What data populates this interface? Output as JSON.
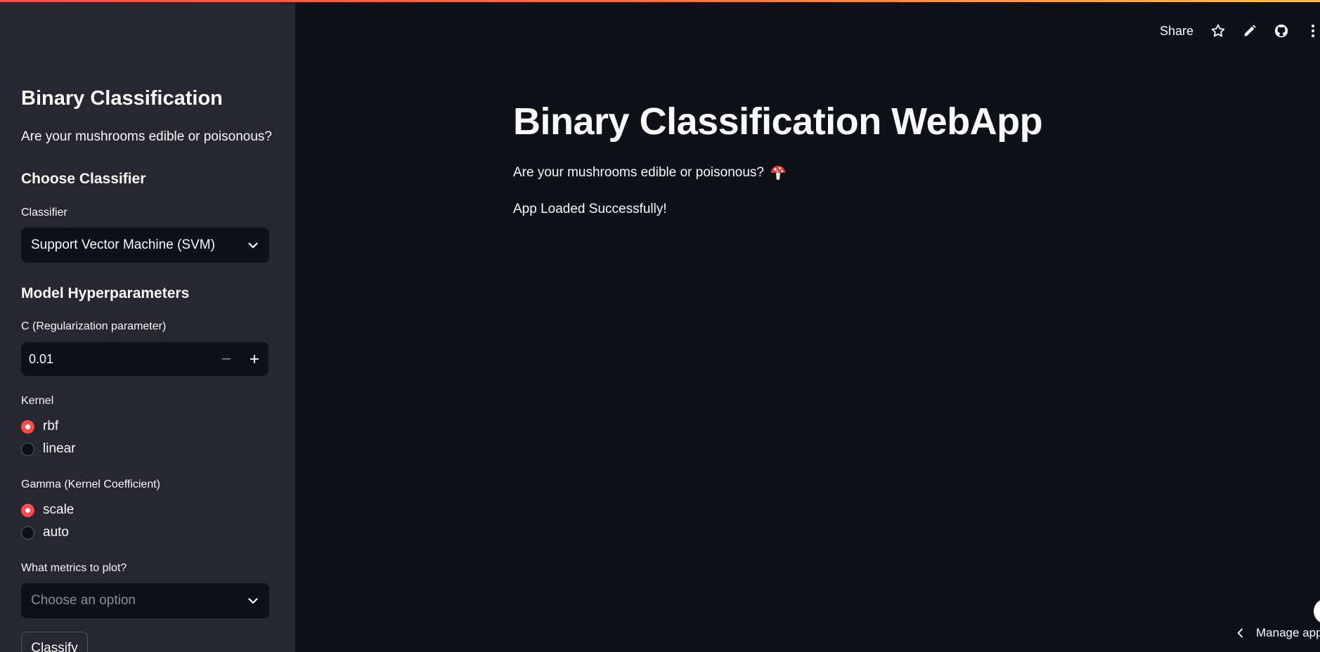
{
  "header": {
    "share_label": "Share",
    "icons": [
      "star-icon",
      "pencil-icon",
      "github-icon",
      "more-vertical-icon"
    ]
  },
  "sidebar": {
    "title": "Binary Classification",
    "subtitle": "Are your mushrooms edible or poisonous?",
    "choose_classifier_heading": "Choose Classifier",
    "classifier_label": "Classifier",
    "classifier_value": "Support Vector Machine (SVM)",
    "hyperparameters_heading": "Model Hyperparameters",
    "c_label": "C (Regularization parameter)",
    "c_value": "0.01",
    "kernel_label": "Kernel",
    "kernel_options": [
      "rbf",
      "linear"
    ],
    "kernel_selected": "rbf",
    "gamma_label": "Gamma (Kernel Coefficient)",
    "gamma_options": [
      "scale",
      "auto"
    ],
    "gamma_selected": "scale",
    "metrics_label": "What metrics to plot?",
    "metrics_placeholder": "Choose an option",
    "classify_label": "Classify"
  },
  "main": {
    "title": "Binary Classification WebApp",
    "subtitle": "Are your mushrooms edible or poisonous?",
    "subtitle_emoji": "mushroom-icon",
    "status": "App Loaded Successfully!"
  },
  "footer": {
    "manage_label": "Manage app"
  },
  "colors": {
    "accent": "#ff4b4b",
    "background": "#0e1117",
    "sidebar": "#262730"
  }
}
